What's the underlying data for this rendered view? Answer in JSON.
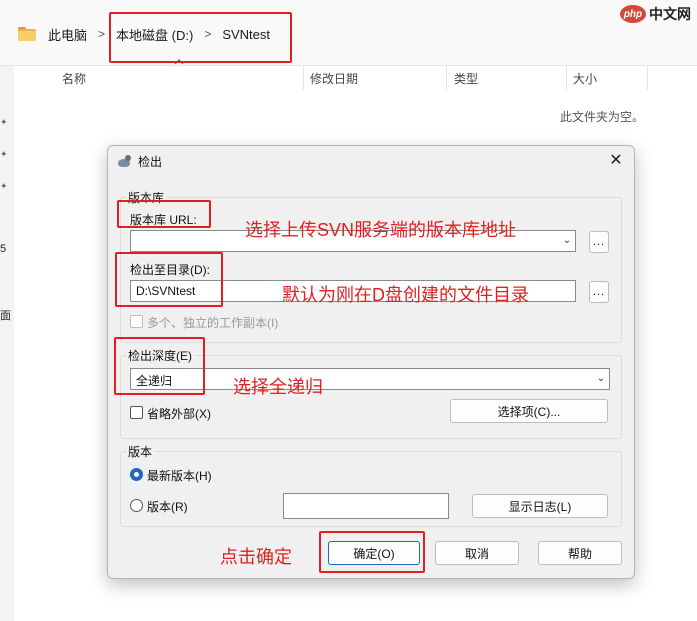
{
  "explorer": {
    "breadcrumb": [
      "此电脑",
      "本地磁盘 (D:)",
      "SVNtest"
    ],
    "columns": [
      "名称",
      "修改日期",
      "类型",
      "大小"
    ],
    "empty_message": "此文件夹为空。",
    "side_texts": [
      "5",
      "面"
    ]
  },
  "watermark": {
    "badge": "php",
    "text": "中文网"
  },
  "dialog": {
    "title": "检出",
    "repository": {
      "group_label": "版本库",
      "url_label": "版本库 URL:",
      "url_value": "",
      "browse_label": "...",
      "checkout_dir_label": "检出至目录(D):",
      "checkout_dir_value": "D:\\SVNtest",
      "browse_dir_label": "...",
      "multiple_label": "多个、独立的工作副本(I)"
    },
    "depth": {
      "group_label": "检出深度(E)",
      "selected": "全递归",
      "omit_externals_label": "省略外部(X)",
      "choose_items_label": "选择项(C)..."
    },
    "revision": {
      "group_label": "版本",
      "head_label": "最新版本(H)",
      "revision_label": "版本(R)",
      "revision_value": "",
      "show_log_label": "显示日志(L)"
    },
    "buttons": {
      "ok": "确定(O)",
      "cancel": "取消",
      "help": "帮助"
    }
  },
  "annotations": {
    "url": "选择上传SVN服务端的版本库地址",
    "dir": "默认为刚在D盘创建的文件目录",
    "depth": "选择全递归",
    "ok": "点击确定"
  },
  "colors": {
    "annotation_red": "#e02020",
    "radio_blue": "#1f67c1"
  }
}
